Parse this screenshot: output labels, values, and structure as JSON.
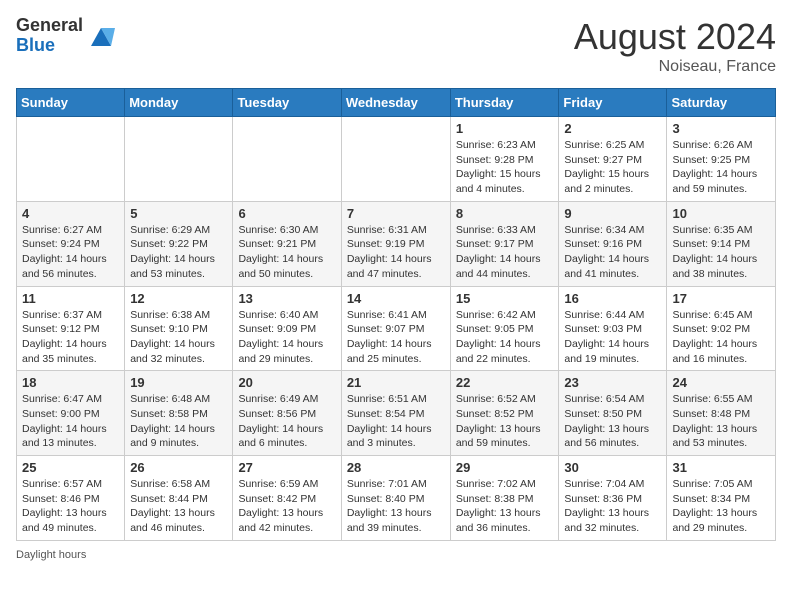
{
  "header": {
    "logo_line1": "General",
    "logo_line2": "Blue",
    "month_year": "August 2024",
    "location": "Noiseau, France"
  },
  "days_of_week": [
    "Sunday",
    "Monday",
    "Tuesday",
    "Wednesday",
    "Thursday",
    "Friday",
    "Saturday"
  ],
  "weeks": [
    [
      null,
      null,
      null,
      null,
      {
        "day": 1,
        "sunrise": "6:23 AM",
        "sunset": "9:28 PM",
        "daylight": "15 hours and 4 minutes."
      },
      {
        "day": 2,
        "sunrise": "6:25 AM",
        "sunset": "9:27 PM",
        "daylight": "15 hours and 2 minutes."
      },
      {
        "day": 3,
        "sunrise": "6:26 AM",
        "sunset": "9:25 PM",
        "daylight": "14 hours and 59 minutes."
      }
    ],
    [
      {
        "day": 4,
        "sunrise": "6:27 AM",
        "sunset": "9:24 PM",
        "daylight": "14 hours and 56 minutes."
      },
      {
        "day": 5,
        "sunrise": "6:29 AM",
        "sunset": "9:22 PM",
        "daylight": "14 hours and 53 minutes."
      },
      {
        "day": 6,
        "sunrise": "6:30 AM",
        "sunset": "9:21 PM",
        "daylight": "14 hours and 50 minutes."
      },
      {
        "day": 7,
        "sunrise": "6:31 AM",
        "sunset": "9:19 PM",
        "daylight": "14 hours and 47 minutes."
      },
      {
        "day": 8,
        "sunrise": "6:33 AM",
        "sunset": "9:17 PM",
        "daylight": "14 hours and 44 minutes."
      },
      {
        "day": 9,
        "sunrise": "6:34 AM",
        "sunset": "9:16 PM",
        "daylight": "14 hours and 41 minutes."
      },
      {
        "day": 10,
        "sunrise": "6:35 AM",
        "sunset": "9:14 PM",
        "daylight": "14 hours and 38 minutes."
      }
    ],
    [
      {
        "day": 11,
        "sunrise": "6:37 AM",
        "sunset": "9:12 PM",
        "daylight": "14 hours and 35 minutes."
      },
      {
        "day": 12,
        "sunrise": "6:38 AM",
        "sunset": "9:10 PM",
        "daylight": "14 hours and 32 minutes."
      },
      {
        "day": 13,
        "sunrise": "6:40 AM",
        "sunset": "9:09 PM",
        "daylight": "14 hours and 29 minutes."
      },
      {
        "day": 14,
        "sunrise": "6:41 AM",
        "sunset": "9:07 PM",
        "daylight": "14 hours and 25 minutes."
      },
      {
        "day": 15,
        "sunrise": "6:42 AM",
        "sunset": "9:05 PM",
        "daylight": "14 hours and 22 minutes."
      },
      {
        "day": 16,
        "sunrise": "6:44 AM",
        "sunset": "9:03 PM",
        "daylight": "14 hours and 19 minutes."
      },
      {
        "day": 17,
        "sunrise": "6:45 AM",
        "sunset": "9:02 PM",
        "daylight": "14 hours and 16 minutes."
      }
    ],
    [
      {
        "day": 18,
        "sunrise": "6:47 AM",
        "sunset": "9:00 PM",
        "daylight": "14 hours and 13 minutes."
      },
      {
        "day": 19,
        "sunrise": "6:48 AM",
        "sunset": "8:58 PM",
        "daylight": "14 hours and 9 minutes."
      },
      {
        "day": 20,
        "sunrise": "6:49 AM",
        "sunset": "8:56 PM",
        "daylight": "14 hours and 6 minutes."
      },
      {
        "day": 21,
        "sunrise": "6:51 AM",
        "sunset": "8:54 PM",
        "daylight": "14 hours and 3 minutes."
      },
      {
        "day": 22,
        "sunrise": "6:52 AM",
        "sunset": "8:52 PM",
        "daylight": "13 hours and 59 minutes."
      },
      {
        "day": 23,
        "sunrise": "6:54 AM",
        "sunset": "8:50 PM",
        "daylight": "13 hours and 56 minutes."
      },
      {
        "day": 24,
        "sunrise": "6:55 AM",
        "sunset": "8:48 PM",
        "daylight": "13 hours and 53 minutes."
      }
    ],
    [
      {
        "day": 25,
        "sunrise": "6:57 AM",
        "sunset": "8:46 PM",
        "daylight": "13 hours and 49 minutes."
      },
      {
        "day": 26,
        "sunrise": "6:58 AM",
        "sunset": "8:44 PM",
        "daylight": "13 hours and 46 minutes."
      },
      {
        "day": 27,
        "sunrise": "6:59 AM",
        "sunset": "8:42 PM",
        "daylight": "13 hours and 42 minutes."
      },
      {
        "day": 28,
        "sunrise": "7:01 AM",
        "sunset": "8:40 PM",
        "daylight": "13 hours and 39 minutes."
      },
      {
        "day": 29,
        "sunrise": "7:02 AM",
        "sunset": "8:38 PM",
        "daylight": "13 hours and 36 minutes."
      },
      {
        "day": 30,
        "sunrise": "7:04 AM",
        "sunset": "8:36 PM",
        "daylight": "13 hours and 32 minutes."
      },
      {
        "day": 31,
        "sunrise": "7:05 AM",
        "sunset": "8:34 PM",
        "daylight": "13 hours and 29 minutes."
      }
    ]
  ],
  "footer": {
    "daylight_label": "Daylight hours"
  }
}
